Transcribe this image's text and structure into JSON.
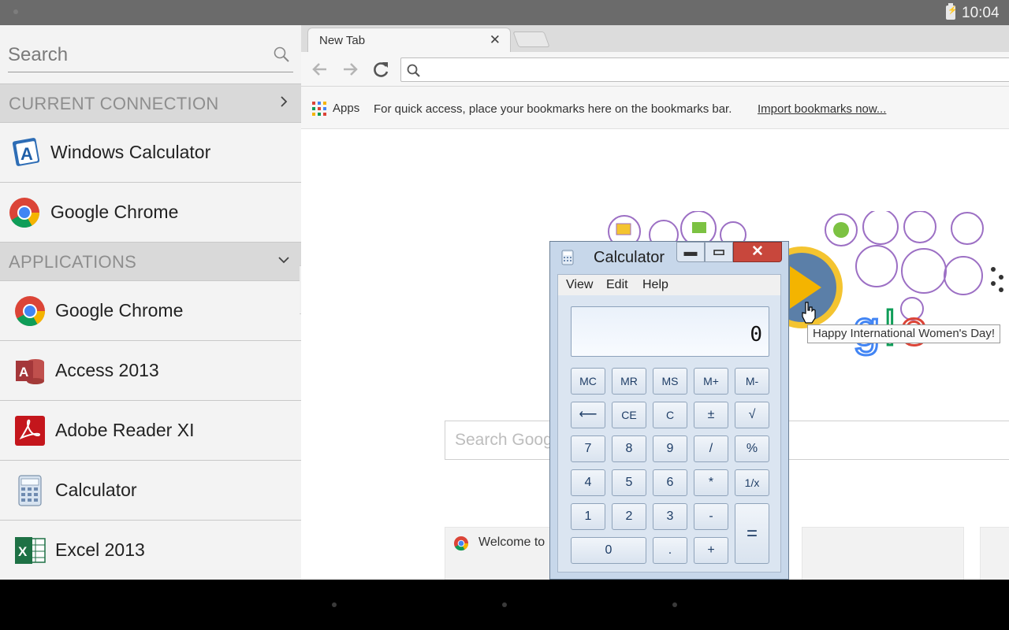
{
  "statusbar": {
    "time": "10:04",
    "icons": [
      "battery-charging-icon"
    ]
  },
  "sidepanel": {
    "search": {
      "placeholder": "Search"
    },
    "current_connection": {
      "header": "CURRENT CONNECTION",
      "items": [
        {
          "label": "Windows Calculator",
          "icon": "remote-app-icon"
        },
        {
          "label": "Google Chrome",
          "icon": "chrome-icon"
        }
      ]
    },
    "applications": {
      "header": "APPLICATIONS",
      "items": [
        {
          "label": "Google Chrome",
          "icon": "chrome-icon"
        },
        {
          "label": "Access 2013",
          "icon": "access-icon"
        },
        {
          "label": "Adobe Reader XI",
          "icon": "adobe-reader-icon"
        },
        {
          "label": "Calculator",
          "icon": "calculator-icon"
        },
        {
          "label": "Excel 2013",
          "icon": "excel-icon"
        }
      ]
    }
  },
  "browser": {
    "tab_title": "New Tab",
    "address": "",
    "bookmarks": {
      "apps_label": "Apps",
      "hint": "For quick access, place your bookmarks here on the bookmarks bar.",
      "import_link": "Import bookmarks now..."
    },
    "doodle_tooltip": "Happy International Women's Day!",
    "search_placeholder": "Search Goog",
    "tile_label": "Welcome to"
  },
  "calculator": {
    "title": "Calculator",
    "menu": [
      "View",
      "Edit",
      "Help"
    ],
    "display": "0",
    "keys": {
      "mc": "MC",
      "mr": "MR",
      "ms": "MS",
      "mplus": "M+",
      "mminus": "M-",
      "back": "⟵",
      "ce": "CE",
      "c": "C",
      "plusminus": "±",
      "sqrt": "√",
      "k7": "7",
      "k8": "8",
      "k9": "9",
      "div": "/",
      "pct": "%",
      "k4": "4",
      "k5": "5",
      "k6": "6",
      "mul": "*",
      "recip": "1/x",
      "k1": "1",
      "k2": "2",
      "k3": "3",
      "sub": "-",
      "eq": "=",
      "k0": "0",
      "dot": ".",
      "add": "+"
    }
  }
}
